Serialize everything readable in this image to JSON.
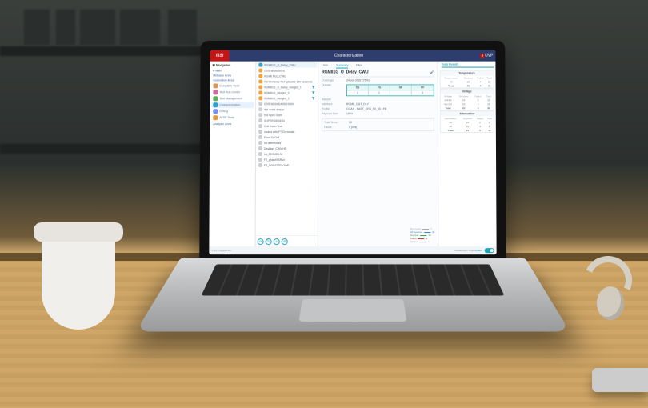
{
  "app": {
    "brand_left": "ISSI",
    "title": "Characterization",
    "brand_right_prefix": "s",
    "brand_right": "UVP"
  },
  "nav": {
    "header": "Navigation",
    "main": "Main",
    "sections": {
      "release": "Release Area",
      "execution": "Execution Area",
      "analytic": "Analytic Area"
    },
    "items": [
      {
        "label": "Execution Tools",
        "color": "#d9995a"
      },
      {
        "label": "Test Run Center",
        "color": "#d16aa1"
      },
      {
        "label": "Test Management",
        "color": "#54b154"
      },
      {
        "label": "Characterization",
        "color": "#2b9ec5",
        "selected": true
      },
      {
        "label": "Debug",
        "color": "#7a8df0"
      },
      {
        "label": "AFSE Tests",
        "color": "#e39a3f"
      }
    ]
  },
  "list": {
    "items": [
      {
        "label": "RGMII1G_O_Delay_CWU",
        "color": "#3fa0c6",
        "selected": true
      },
      {
        "label": "DDS all sessions",
        "color": "#f0a63c"
      },
      {
        "label": "RGMII FULLCWU",
        "color": "#f0a63c"
      },
      {
        "label": "Performance PLT qdouble 18V sessions",
        "color": "#f0a63c"
      },
      {
        "label": "RGMII1G_O_Delay_merged_1",
        "color": "#f0a63c",
        "filter": true
      },
      {
        "label": "RGMII1G_merged_2",
        "color": "#f0a63c",
        "filter": true
      },
      {
        "label": "RGMII1G_merged_1",
        "color": "#f0a63c",
        "filter": true
      },
      {
        "label": "DDS SEGMEASDESIGN",
        "color": "#c9cfd4"
      },
      {
        "label": "link world design",
        "color": "#c9cfd4"
      },
      {
        "label": "hrd Spec Open",
        "color": "#c9cfd4"
      },
      {
        "label": "SUPER DESIGN",
        "color": "#c9cfd4"
      },
      {
        "label": "Drill Down Test",
        "color": "#c9cfd4"
      },
      {
        "label": "xooind with FT Chromatic",
        "color": "#c9cfd4"
      },
      {
        "label": "From To Drill",
        "color": "#c9cfd4"
      },
      {
        "label": "Int differences",
        "color": "#c9cfd4"
      },
      {
        "label": "Desktop_CWV HD",
        "color": "#c9cfd4"
      },
      {
        "label": "Int_DESIGN 02",
        "color": "#c9cfd4"
      },
      {
        "label": "FT_phaseSSRun",
        "color": "#c9cfd4"
      },
      {
        "label": "FT_DDSATTELOOP",
        "color": "#c9cfd4"
      }
    ],
    "toolbar_hint": "tools"
  },
  "details": {
    "tabs": [
      "Info",
      "Summary",
      "Files"
    ],
    "active_tab": 1,
    "name": "RGMII1G_O_Delay_CWU",
    "coverage_label": "Coverage",
    "coverage": "24 out of 32 (75%)",
    "domain_label": "Domain",
    "domain": {
      "headers": [
        "SS",
        "FS",
        "SF",
        "FF"
      ],
      "row": [
        "1",
        "1",
        "",
        "2"
      ]
    },
    "sample_label": "Sample",
    "sample": "",
    "interface_label": "Interface",
    "interface": "RGMII_OUT_DLY",
    "profile_label": "Profile",
    "profile": "COAX - FAST_CFG_50_50 - FB",
    "payload_label": "Payload Size",
    "payload": "1024",
    "total_label": "Total Tests",
    "total": "32",
    "faults_label": "Faults",
    "faults": "0 (0%)",
    "run_legend": [
      {
        "label": "Run Count",
        "class": "gray",
        "val": "7"
      },
      {
        "label": "All Sessions",
        "class": "blue",
        "val": "32"
      },
      {
        "label": "Success",
        "class": "green",
        "val": "24"
      },
      {
        "label": "Failed",
        "class": "red",
        "val": "4"
      },
      {
        "label": "Aborted",
        "class": "gray",
        "val": "4"
      }
    ]
  },
  "results": {
    "tab": "Tests Results",
    "panels": [
      {
        "title": "Temperature",
        "headers": [
          "Temperature",
          "Success",
          "Failed",
          "Total"
        ],
        "rows": [
          [
            "-40",
            "20",
            "4",
            "32"
          ]
        ],
        "total": [
          "Total",
          "20",
          "4",
          "32"
        ]
      },
      {
        "title": "Voltage",
        "headers": [
          "Voltage",
          "Success",
          "Failed",
          "Total"
        ],
        "rows": [
          [
            "V-0.9V",
            "10",
            "2",
            "15"
          ],
          [
            "V-1.1 V",
            "10",
            "2",
            "15"
          ]
        ],
        "total": [
          "Total",
          "20",
          "4",
          "30"
        ]
      },
      {
        "title": "Attenuation",
        "headers": [
          "Attenuation",
          "Success",
          "Failed",
          "Total"
        ],
        "rows": [
          [
            "16",
            "13",
            "2",
            "8"
          ],
          [
            "28",
            "11",
            "3",
            "8"
          ]
        ],
        "total": [
          "Total",
          "24",
          "5",
          "16"
        ]
      }
    ]
  },
  "status": {
    "left": "©2019 Digital UVP",
    "right_label": "Visualization Style",
    "right_link": "Default"
  }
}
